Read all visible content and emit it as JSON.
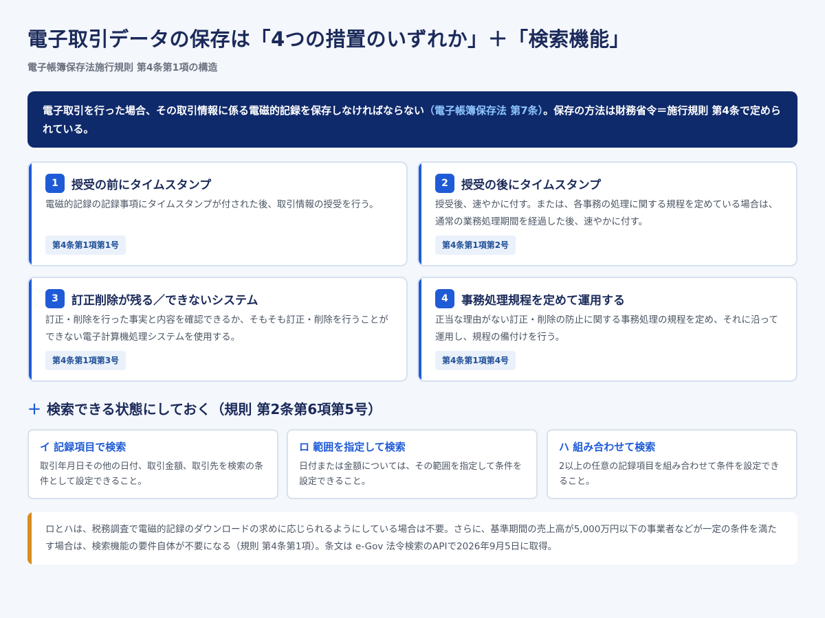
{
  "header": {
    "title": "電子取引データの保存は「4つの措置のいずれか」＋「検索機能」",
    "subtitle": "電子帳簿保存法施行規則 第4条第1項の構造"
  },
  "banner": {
    "text_before": "電子取引を行った場合、その取引情報に係る電磁的記録を保存しなければならない",
    "highlight": "（電子帳簿保存法 第7条）",
    "text_after": "。保存の方法は財務省令＝施行規則 第4条で定められている。"
  },
  "measures": [
    {
      "number": "1",
      "title": "授受の前にタイムスタンプ",
      "description": "電磁的記録の記録事項にタイムスタンプが付された後、取引情報の授受を行う。",
      "tag": "第4条第1項第1号"
    },
    {
      "number": "2",
      "title": "授受の後にタイムスタンプ",
      "description": "授受後、速やかに付す。または、各事務の処理に関する規程を定めている場合は、通常の業務処理期間を経過した後、速やかに付す。",
      "tag": "第4条第1項第2号"
    },
    {
      "number": "3",
      "title": "訂正削除が残る／できないシステム",
      "description": "訂正・削除を行った事実と内容を確認できるか、そもそも訂正・削除を行うことができない電子計算機処理システムを使用する。",
      "tag": "第4条第1項第3号"
    },
    {
      "number": "4",
      "title": "事務処理規程を定めて運用する",
      "description": "正当な理由がない訂正・削除の防止に関する事務処理の規程を定め、それに沿って運用し、規程の備付けを行う。",
      "tag": "第4条第1項第4号"
    }
  ],
  "search": {
    "plus": "＋",
    "heading": "検索できる状態にしておく（規則 第2条第6項第5号）",
    "cards": [
      {
        "title": "イ 記録項目で検索",
        "description": "取引年月日その他の日付、取引金額、取引先を検索の条件として設定できること。"
      },
      {
        "title": "ロ 範囲を指定して検索",
        "description": "日付または金額については、その範囲を指定して条件を設定できること。"
      },
      {
        "title": "ハ 組み合わせて検索",
        "description": "2以上の任意の記録項目を組み合わせて条件を設定できること。"
      }
    ]
  },
  "note": {
    "text": "ロとハは、税務調査で電磁的記録のダウンロードの求めに応じられるようにしている場合は不要。さらに、基準期間の売上高が5,000万円以下の事業者などが一定の条件を満たす場合は、検索機能の要件自体が不要になる（規則 第4条第1項）。条文は e-Gov 法令検索のAPIで2026年9月5日に取得。"
  },
  "colors": {
    "navy": "#0f2a6b",
    "accent_blue": "#1f5bd6",
    "highlight_blue": "#8ec5ff",
    "note_orange": "#d98c1f"
  }
}
